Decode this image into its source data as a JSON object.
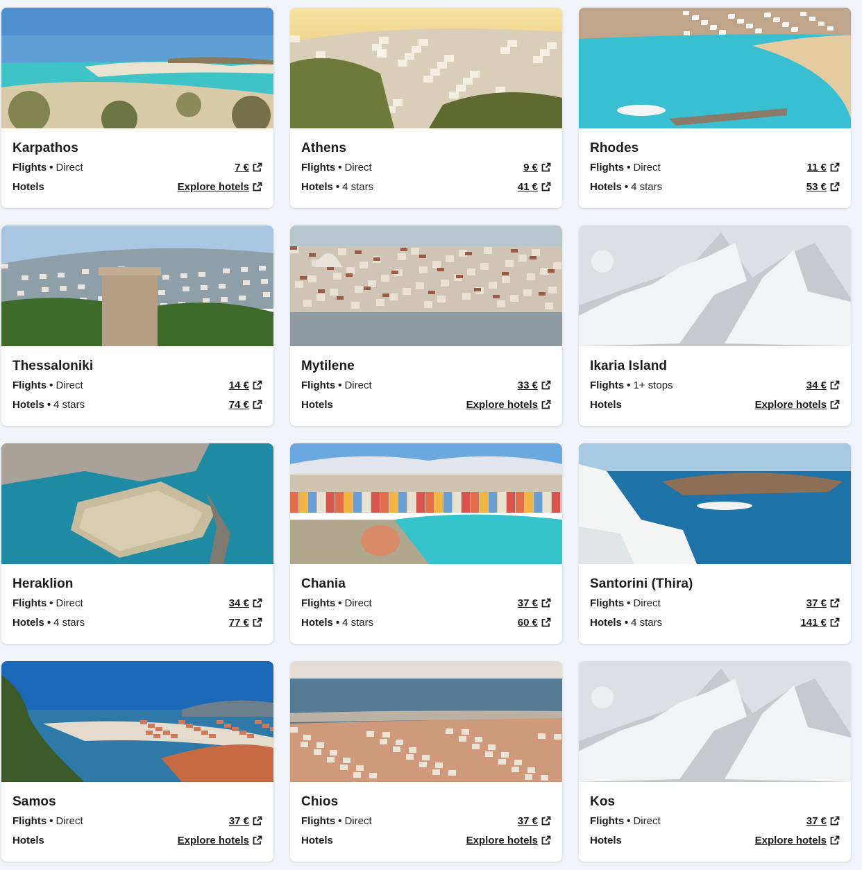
{
  "labels": {
    "flights": "Flights",
    "hotels": "Hotels",
    "separator": "•"
  },
  "icons": {
    "external": "external-link-icon",
    "placeholder": "mountain-placeholder-icon"
  },
  "cards": [
    {
      "name": "Karpathos",
      "flight_detail": "Direct",
      "flight_price": "7 €",
      "hotel_detail": "",
      "hotel_price": "Explore hotels",
      "scene": "beach"
    },
    {
      "name": "Athens",
      "flight_detail": "Direct",
      "flight_price": "9 €",
      "hotel_detail": "4 stars",
      "hotel_price": "41 €",
      "scene": "city"
    },
    {
      "name": "Rhodes",
      "flight_detail": "Direct",
      "flight_price": "11 €",
      "hotel_detail": "4 stars",
      "hotel_price": "53 €",
      "scene": "bay"
    },
    {
      "name": "Thessaloniki",
      "flight_detail": "Direct",
      "flight_price": "14 €",
      "hotel_detail": "4 stars",
      "hotel_price": "74 €",
      "scene": "tower"
    },
    {
      "name": "Mytilene",
      "flight_detail": "Direct",
      "flight_price": "33 €",
      "hotel_detail": "",
      "hotel_price": "Explore hotels",
      "scene": "harbor"
    },
    {
      "name": "Ikaria Island",
      "flight_detail": "1+ stops",
      "flight_price": "34 €",
      "hotel_detail": "",
      "hotel_price": "Explore hotels",
      "scene": "placeholder"
    },
    {
      "name": "Heraklion",
      "flight_detail": "Direct",
      "flight_price": "34 €",
      "hotel_detail": "4 stars",
      "hotel_price": "77 €",
      "scene": "fortress"
    },
    {
      "name": "Chania",
      "flight_detail": "Direct",
      "flight_price": "37 €",
      "hotel_detail": "4 stars",
      "hotel_price": "60 €",
      "scene": "port"
    },
    {
      "name": "Santorini (Thira)",
      "flight_detail": "Direct",
      "flight_price": "37 €",
      "hotel_detail": "4 stars",
      "hotel_price": "141 €",
      "scene": "caldera"
    },
    {
      "name": "Samos",
      "flight_detail": "Direct",
      "flight_price": "37 €",
      "hotel_detail": "",
      "hotel_price": "Explore hotels",
      "scene": "coast"
    },
    {
      "name": "Chios",
      "flight_detail": "Direct",
      "flight_price": "37 €",
      "hotel_detail": "",
      "hotel_price": "Explore hotels",
      "scene": "town"
    },
    {
      "name": "Kos",
      "flight_detail": "Direct",
      "flight_price": "37 €",
      "hotel_detail": "",
      "hotel_price": "Explore hotels",
      "scene": "placeholder"
    }
  ]
}
